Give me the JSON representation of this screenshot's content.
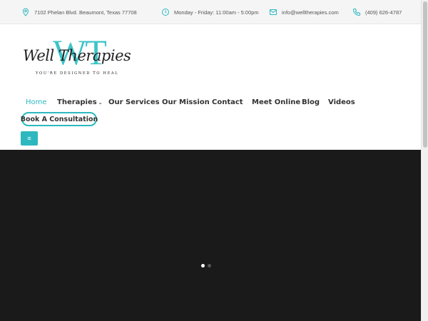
{
  "topbar": {
    "address": "7102 Phelan Blvd. Beaumont, Texas 77708",
    "hours": "Monday - Friday: 11:00am - 5:00pm",
    "email": "info@welltherapies.com",
    "phone": "(409) 626-4787",
    "icons": [
      "map-pin-icon",
      "clock-icon",
      "mail-icon",
      "phone-icon"
    ],
    "icon_color": "#2db8c0"
  },
  "logo": {
    "monogram": "WT",
    "name": "Well Therapies",
    "tagline": "YOU'RE DESIGNED TO HEAL",
    "accent_color": "#3cc4c8"
  },
  "nav": {
    "items": [
      {
        "label": "Home",
        "active": true
      },
      {
        "label": "Therapies",
        "has_dropdown": true
      },
      {
        "label": "Our Services"
      },
      {
        "label": "Our Mission"
      },
      {
        "label": "Contact"
      },
      {
        "label": "Meet Online"
      },
      {
        "label": "Blog"
      },
      {
        "label": "Videos"
      }
    ],
    "dropdown_glyph": "⌄",
    "cta_label": "Book A Consultation",
    "menu_glyph": "≡",
    "accent_color": "#2db8c0"
  },
  "hero": {
    "background": "#1a1a1a",
    "slide_count": 2,
    "active_slide": 1
  }
}
